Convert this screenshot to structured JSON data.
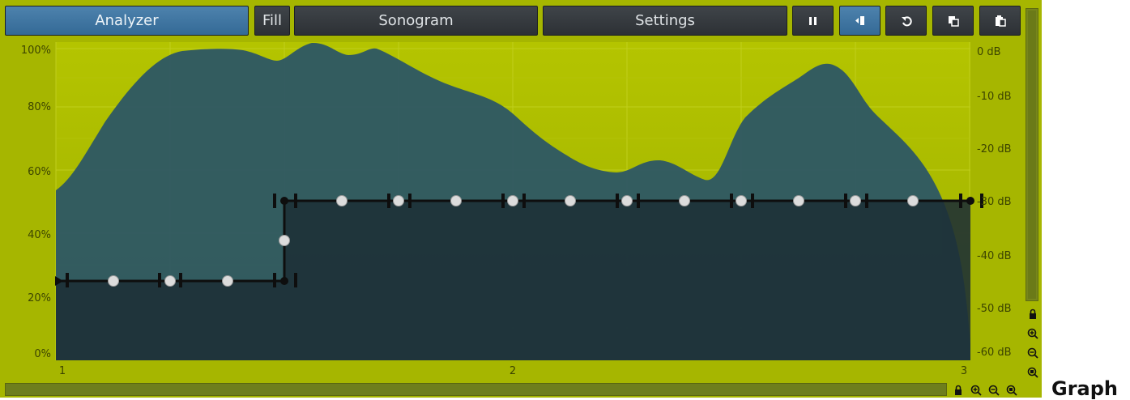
{
  "toolbar": {
    "analyzer_label": "Analyzer",
    "fill_label": "Fill",
    "sonogram_label": "Sonogram",
    "settings_label": "Settings",
    "icons": [
      "pause-icon",
      "freeze-icon",
      "reset-icon",
      "copy-icon",
      "paste-icon"
    ]
  },
  "graph": {
    "y_left_ticks": [
      "100%",
      "80%",
      "60%",
      "40%",
      "20%",
      "0%"
    ],
    "y_right_ticks": [
      "0 dB",
      "-10 dB",
      "-20 dB",
      "-30 dB",
      "-40 dB",
      "-50 dB",
      "-60 dB"
    ],
    "x_ticks": [
      "1",
      "2",
      "3"
    ]
  },
  "caption": "Graph",
  "colors": {
    "panel": "#a6b600",
    "spectrum_fill": "#2c5664",
    "active_button": "#3d76a3",
    "curve": "#111111"
  }
}
